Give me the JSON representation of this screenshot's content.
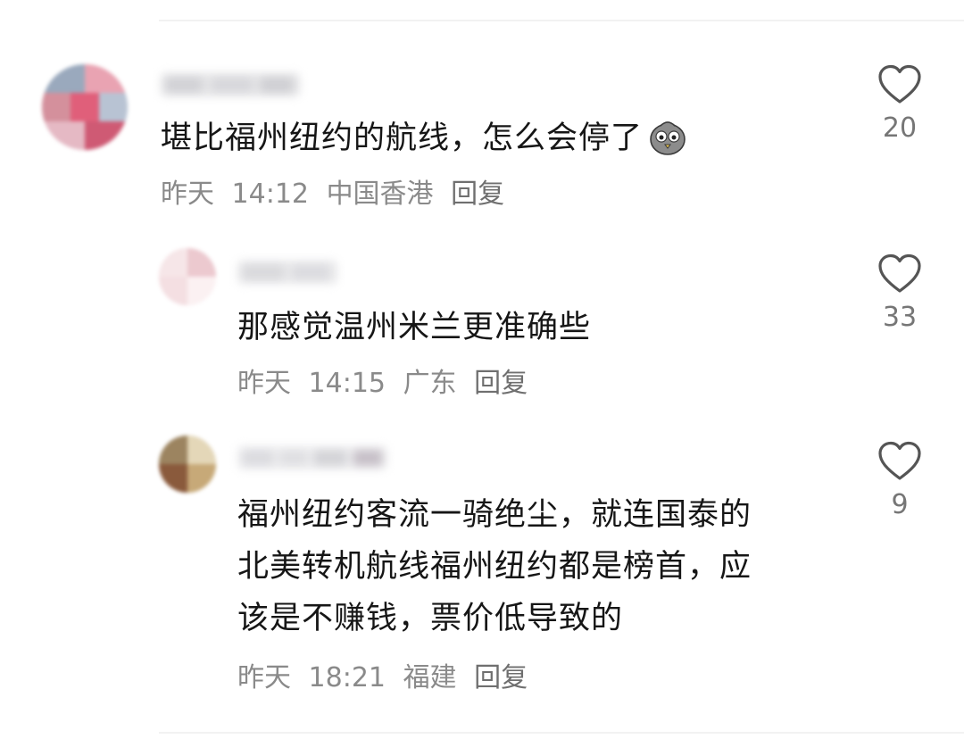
{
  "comments": [
    {
      "text": "堪比福州纽约的航线，怎么会停了",
      "emoji": "speechless-pigeon-emoji",
      "date": "昨天",
      "time": "14:12",
      "location": "中国香港",
      "reply_label": "回复",
      "likes": "20"
    },
    {
      "text": "那感觉温州米兰更准确些",
      "date": "昨天",
      "time": "14:15",
      "location": "广东",
      "reply_label": "回复",
      "likes": "33"
    },
    {
      "text_lines": [
        "福州纽约客流一骑绝尘，就连国泰的",
        "北美转机航线福州纽约都是榜首，应",
        "该是不赚钱，票价低导致的"
      ],
      "date": "昨天",
      "time": "18:21",
      "location": "福建",
      "reply_label": "回复",
      "likes": "9"
    }
  ],
  "icons": {
    "like": "heart-outline-icon",
    "avatar": "pixelated-avatar"
  },
  "colors": {
    "text": "#161616",
    "meta": "#8a8a8a",
    "icon": "#555555",
    "background": "#ffffff"
  }
}
